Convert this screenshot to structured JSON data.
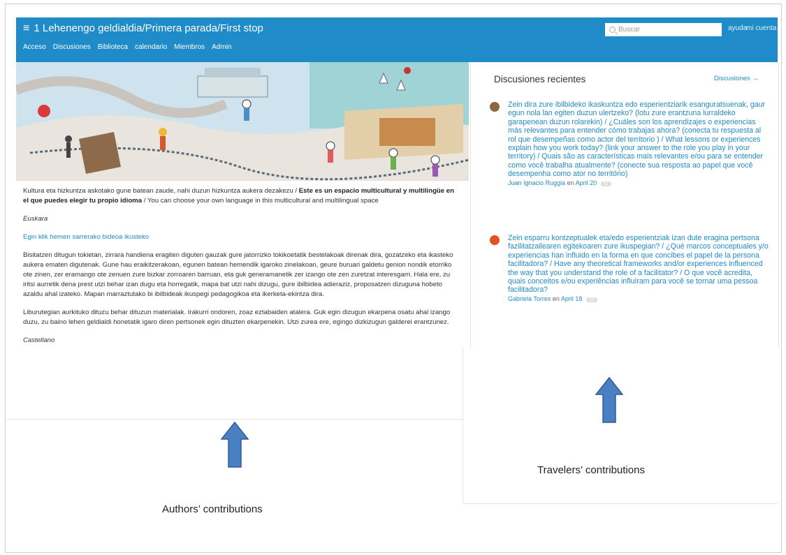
{
  "app": {
    "title": "1 Lehenengo geldialdia/Primera parada/First stop",
    "search_placeholder": "Buscar",
    "help_link": "ayuda",
    "account_link": "mi cuenta",
    "nav": [
      "Acceso",
      "Discusiones",
      "Biblioteca",
      "calendario",
      "Miembros",
      "Admin"
    ],
    "brand_color": "#1f8bc8"
  },
  "content": {
    "intro_plain": "Kultura eta hizkuntza askotako gune batean zaude, nahi duzun hizkuntza aukera dezakezu / ",
    "intro_bold": "Este es un espacio multicultural y multilingüe en el que puedes elegir tu propio idioma",
    "intro_tail": " / You can choose your own language in this multicultural and multilingual space",
    "lang_euskara": "Euskara",
    "video_link": "Egin klik hemen sarrerako bideoa ikusteko",
    "para1": "Bisitatzen ditugun tokietan, zirrara handiena eragiten diguten gauzak gure jatorrizko tokikoetatik bestelakoak direnak dira, gozatzeko eta ikasteko aukera ematen digutenak. Gune hau eraikitzerakoan, egunen batean hemendik igaroko zinelakoan, geure buruari galdetu genion nondik etorriko ote zinen, zer eramango ote zenuen zure bizkar zorroaren barruan, eta guk generamanetik zer izango ote zen zuretzat interesgarri. Hala ere, zu iritsi aurretik dena prest utzi behar izan dugu eta horregatik, mapa bat utzi nahi dizugu, gure ibilbidea adieraziz, proposatzen dizuguna hobeto azaldu ahal izateko. Mapan marraztutako bi ibilbideak ikuspegi pedagogikoa eta ikerketa-ekintza dira.",
    "para2": "Liburutegian aurkituko dituzu behar dituzun materialak. Irakurri ondoren, zoaz eztabaiden atalera. Guk egin dizugun ekarpena osatu ahal izango duzu, zu baino lehen geldialdi honetatik igaro diren pertsonek egin dituzten ekarpenekin. Utzi zurea ere, egingo dizkizugun galderei erantzunez.",
    "lang_castellano": "Castellano"
  },
  "discussions": {
    "heading": "Discusiones recientes",
    "more_link": "Discusiones →",
    "items": [
      {
        "text": "Zein dira zure ibilbideko ikaskuntza edo esperientziarik esanguratsuenak, gaur egun nola lan egiten duzun ulertzeko? (lotu zure erantzuna lurraldeko garapenean duzun rolarekin) / ¿Cuáles son los aprendizajes o experiencias más relevantes para entender cómo trabajas ahora? (conecta tu respuesta al rol que desempeñas como actor del territorio ) / What lessons or experiences explain how you work today? (link your answer to the role you play in your territory) / Quais são as características mais relevantes e/ou para se entender como você trabalha atualmente? (conecte sua resposta ao papel que você desempenha como ator no território)",
        "author": "Juan Ignacio Ruggia",
        "en": "en",
        "date": "April 20",
        "count": "11",
        "avatar_color": "#8a6a3c"
      },
      {
        "text": "Zein esparru kontzeptualek eta/edo esperientziak izan dute eragina pertsona fazilitatzailearen egitekoaren zure ikuspegian? / ¿Qué marcos conceptuales y/o experiencias han influido en la forma en que concibes el papel de la persona facilitadora? / Have any theoretical frameworks and/or experiences influenced the way that you understand the role of a facilitator? / O que você acredita, quais conceitos e/ou experiências influíram para você se tornar uma pessoa facilitadora?",
        "author": "Gabriela Torres",
        "en": "en",
        "date": "April 18",
        "count": "29",
        "avatar_color": "#e0531f"
      }
    ]
  },
  "annotations": {
    "authors": "Authors’ contributions",
    "travelers": "Travelers’ contributions",
    "arrow_color": "#4a7fc1"
  }
}
